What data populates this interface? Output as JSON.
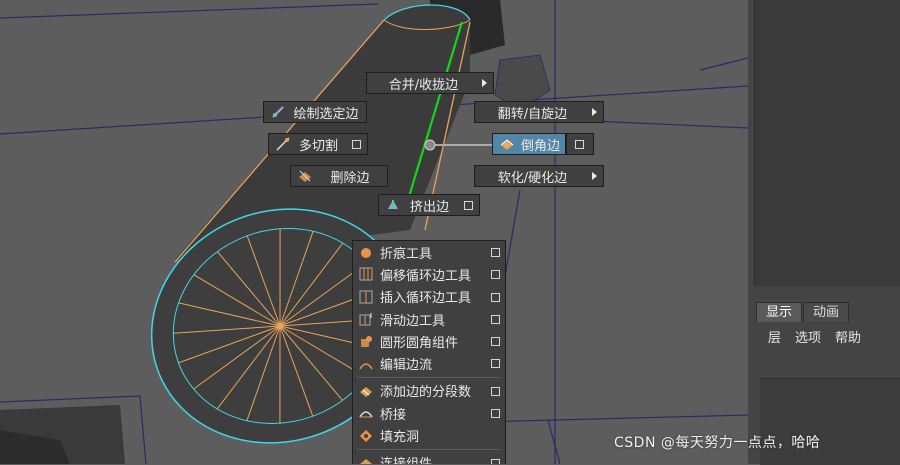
{
  "marking_menu": {
    "north": {
      "label": "合并/收拢边",
      "icon": "submenu-arrow-icon"
    },
    "northwest": {
      "label": "绘制选定边",
      "icon": "paint-edge-icon"
    },
    "northeast": {
      "label": "翻转/自旋边",
      "icon": "submenu-arrow-icon"
    },
    "west": {
      "label": "多切割",
      "icon": "multi-cut-icon"
    },
    "east": {
      "label": "倒角边",
      "icon": "bevel-icon",
      "highlighted": true
    },
    "southwest": {
      "label": "删除边",
      "icon": "delete-edge-icon"
    },
    "southeast": {
      "label": "软化/硬化边",
      "icon": "submenu-arrow-icon"
    },
    "south": {
      "label": "挤出边",
      "icon": "extrude-icon"
    }
  },
  "submenu": {
    "items": [
      {
        "label": "折痕工具",
        "icon": "crease-icon"
      },
      {
        "label": "偏移循环边工具",
        "icon": "offset-loop-icon"
      },
      {
        "label": "插入循环边工具",
        "icon": "insert-loop-icon"
      },
      {
        "label": "滑动边工具",
        "icon": "slide-edge-icon"
      },
      {
        "label": "圆形圆角组件",
        "icon": "circularize-icon"
      },
      {
        "label": "编辑边流",
        "icon": "edit-edge-flow-icon"
      },
      {
        "label": "添加边的分段数",
        "icon": "add-divisions-icon"
      },
      {
        "label": "桥接",
        "icon": "bridge-icon"
      },
      {
        "label": "填充洞",
        "icon": "fill-hole-icon"
      },
      {
        "label": "连接组件",
        "icon": "connect-icon"
      }
    ]
  },
  "right_panel": {
    "tabs": [
      "显示",
      "动画"
    ],
    "active_tab": "显示",
    "menu": [
      "层",
      "选项",
      "帮助"
    ]
  },
  "watermark": "CSDN @每天努力一点点，哈哈",
  "colors": {
    "highlight": "#5285a6",
    "edge_selected": "#19d219",
    "wire_orange": "#e8a35c",
    "wire_cyan": "#40d8e8"
  }
}
